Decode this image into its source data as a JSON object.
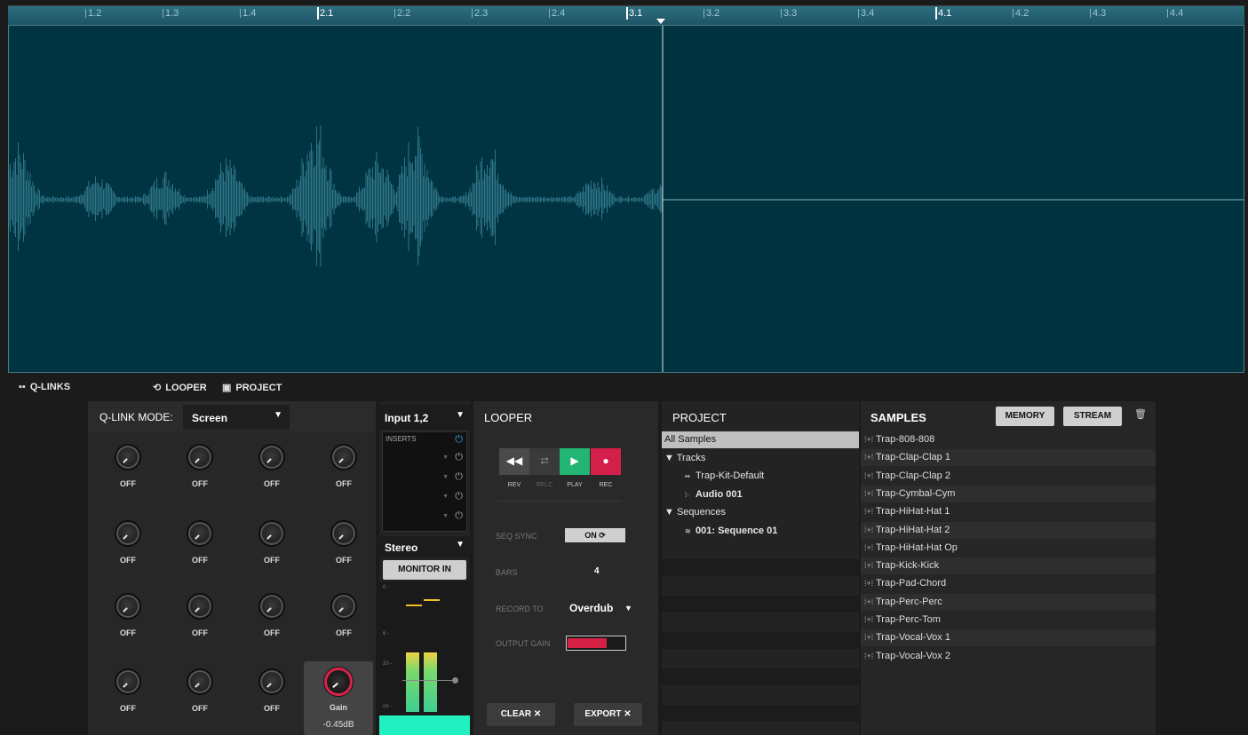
{
  "ruler": {
    "ticks": [
      "1.2",
      "1.3",
      "1.4",
      "2.1",
      "2.2",
      "2.3",
      "2.4",
      "3.1",
      "3.2",
      "3.3",
      "3.4",
      "4.1",
      "4.2",
      "4.3",
      "4.4"
    ]
  },
  "tabs": {
    "qlinks": "Q-LINKS",
    "looper": "LOOPER",
    "project": "PROJECT"
  },
  "qlink": {
    "mode_label": "Q-LINK MODE:",
    "mode_value": "Screen",
    "knob_label": "OFF",
    "gain_label": "Gain",
    "gain_value": "-0.45dB"
  },
  "strip": {
    "input": "Input 1,2",
    "inserts_label": "INSERTS",
    "output": "Stereo",
    "monitor": "MONITOR IN",
    "meter_levels": [
      0.75,
      0.75
    ],
    "scale": [
      "0 -",
      "6 -",
      "20 -",
      "oo -"
    ]
  },
  "looper": {
    "title": "LOOPER",
    "buttons": [
      {
        "label": "REV",
        "icon": "rewind-icon",
        "glyph": "◀◀",
        "color": "#4a4a4a"
      },
      {
        "label": "RFLC",
        "icon": "loop-icon",
        "glyph": "⮂",
        "color": "#3a3a3a"
      },
      {
        "label": "PLAY",
        "icon": "play-icon",
        "glyph": "▶",
        "color": "#22b573"
      },
      {
        "label": "REC",
        "icon": "record-icon",
        "glyph": "●",
        "color": "#d51f4b"
      }
    ],
    "seq_sync_label": "SEQ SYNC",
    "seq_sync_value": "ON ⟳",
    "bars_label": "BARS",
    "bars_value": "4",
    "record_to_label": "RECORD TO",
    "record_to_value": "Overdub",
    "output_gain_label": "OUTPUT GAIN",
    "output_gain_level": 0.66,
    "clear": "CLEAR ✕",
    "export": "EXPORT ✕"
  },
  "project": {
    "title": "PROJECT",
    "rows": [
      {
        "label": "All Samples",
        "indent": 0,
        "icon": "",
        "bold": false
      },
      {
        "label": "▼ Tracks",
        "indent": 0,
        "icon": "",
        "bold": false
      },
      {
        "label": "Trap-Kit-Default",
        "indent": 1,
        "icon": "▪▪",
        "bold": false
      },
      {
        "label": "Audio 001",
        "indent": 1,
        "icon": "⁞·",
        "bold": true
      },
      {
        "label": "▼ Sequences",
        "indent": 0,
        "icon": "",
        "bold": false
      },
      {
        "label": "001: Sequence 01",
        "indent": 1,
        "icon": "≋",
        "bold": true
      }
    ]
  },
  "samples": {
    "title": "SAMPLES",
    "memory": "MEMORY",
    "stream": "STREAM",
    "items": [
      "Trap-808-808",
      "Trap-Clap-Clap 1",
      "Trap-Clap-Clap 2",
      "Trap-Cymbal-Cym",
      "Trap-HiHat-Hat 1",
      "Trap-HiHat-Hat 2",
      "Trap-HiHat-Hat Op",
      "Trap-Kick-Kick",
      "Trap-Pad-Chord",
      "Trap-Perc-Perc",
      "Trap-Perc-Tom",
      "Trap-Vocal-Vox 1",
      "Trap-Vocal-Vox 2"
    ]
  }
}
